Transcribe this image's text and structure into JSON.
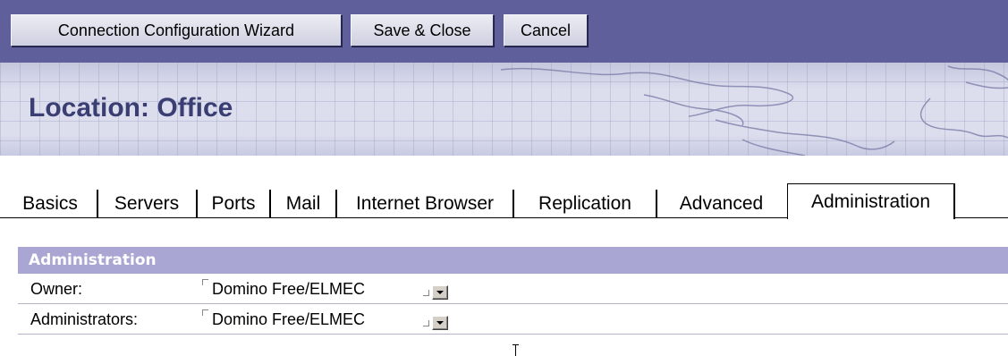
{
  "toolbar": {
    "wizard_label": "Connection Configuration Wizard",
    "save_label": "Save & Close",
    "cancel_label": "Cancel"
  },
  "banner": {
    "title": "Location: Office"
  },
  "tabs": [
    {
      "label": "Basics"
    },
    {
      "label": "Servers"
    },
    {
      "label": "Ports"
    },
    {
      "label": "Mail"
    },
    {
      "label": "Internet Browser"
    },
    {
      "label": "Replication"
    },
    {
      "label": "Advanced"
    },
    {
      "label": "Administration",
      "active": true
    }
  ],
  "section": {
    "title": "Administration",
    "fields": [
      {
        "label": "Owner:",
        "value": "Domino Free/ELMEC"
      },
      {
        "label": "Administrators:",
        "value": "Domino Free/ELMEC"
      }
    ]
  },
  "colors": {
    "toolbar_bg": "#5f5f9c",
    "title_text": "#3a3e72",
    "section_header_bg": "#a9a6d3"
  }
}
